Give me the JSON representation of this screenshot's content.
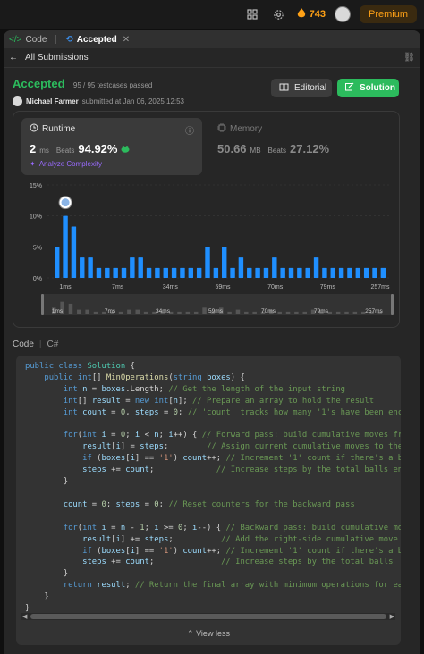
{
  "topbar": {
    "streak_count": "743",
    "premium_label": "Premium",
    "icons": [
      "layout-icon",
      "gear-icon",
      "fire-icon",
      "avatar"
    ]
  },
  "tabs": [
    {
      "label": "Code",
      "icon": "code-icon"
    },
    {
      "label": "Accepted",
      "icon": "history-icon"
    }
  ],
  "breadcrumb": {
    "back_label": "All Submissions"
  },
  "submission": {
    "status": "Accepted",
    "tests": "95 / 95 testcases passed",
    "user": "Michael Farmer",
    "submitted": "submitted at Jan 06, 2025 12:53",
    "editorial_label": "Editorial",
    "solution_label": "Solution"
  },
  "runtime": {
    "label": "Runtime",
    "value": "2",
    "unit": "ms",
    "beats_label": "Beats",
    "beats_pct": "94.92%",
    "analyze_label": "Analyze Complexity"
  },
  "memory": {
    "label": "Memory",
    "value": "50.66",
    "unit": "MB",
    "beats_label": "Beats",
    "beats_pct": "27.12%"
  },
  "chart_data": {
    "type": "bar",
    "y_ticks": [
      "15%",
      "10%",
      "5%",
      "0%"
    ],
    "ylim": [
      0,
      15
    ],
    "x_tick_labels": [
      "1ms",
      "7ms",
      "34ms",
      "59ms",
      "70ms",
      "79ms",
      "257ms"
    ],
    "values": [
      5,
      10,
      8.3,
      3.3,
      3.3,
      1.6,
      1.6,
      1.6,
      1.6,
      3.3,
      3.3,
      1.6,
      1.6,
      1.6,
      1.6,
      1.6,
      1.6,
      1.6,
      5,
      1.6,
      5,
      1.6,
      3.3,
      1.6,
      1.6,
      1.6,
      3.3,
      1.6,
      1.6,
      1.6,
      1.6,
      3.3,
      1.6,
      1.6,
      1.6,
      1.6,
      1.6,
      1.6,
      1.6,
      1.6
    ],
    "highlight_index": 1,
    "color": "#1f8fff",
    "overview_tick_labels": [
      "1ms",
      "7ms",
      "34ms",
      "59ms",
      "70ms",
      "79ms",
      "257ms"
    ],
    "grid": true
  },
  "code": {
    "section_label": "Code",
    "language": "C#",
    "view_less_label": "View less"
  }
}
